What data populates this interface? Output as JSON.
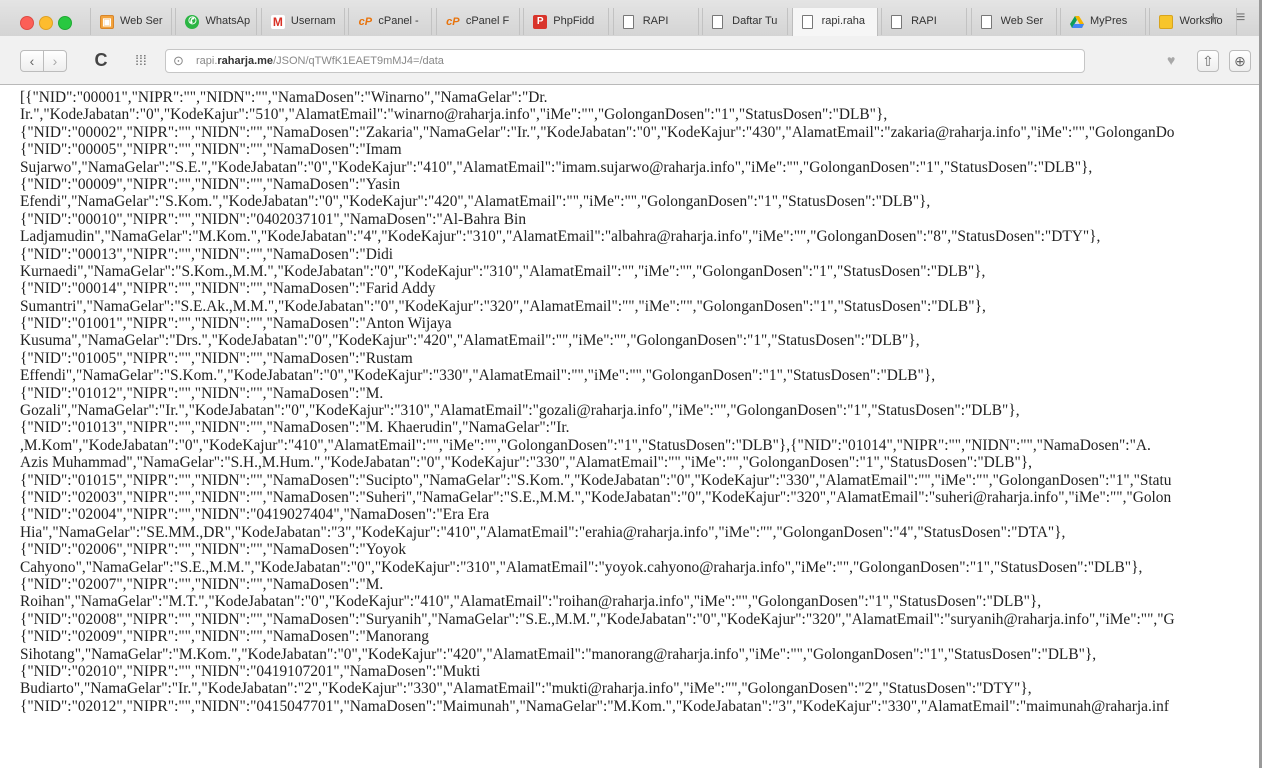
{
  "window": {
    "tabs": [
      {
        "label": "Web Ser",
        "icon": "document-icon",
        "active": false
      },
      {
        "label": "WhatsAp",
        "icon": "whatsapp-icon",
        "active": false
      },
      {
        "label": "Usernam",
        "icon": "gmail-icon",
        "active": false
      },
      {
        "label": "cPanel -",
        "icon": "cpanel-icon",
        "active": false
      },
      {
        "label": "cPanel F",
        "icon": "cpanel-icon",
        "active": false
      },
      {
        "label": "PhpFidd",
        "icon": "phpfiddle-icon",
        "active": false
      },
      {
        "label": "RAPI",
        "icon": "page-icon",
        "active": false
      },
      {
        "label": "Daftar Tu",
        "icon": "page-icon",
        "active": false
      },
      {
        "label": "rapi.raha",
        "icon": "page-icon",
        "active": true
      },
      {
        "label": "RAPI",
        "icon": "page-icon",
        "active": false
      },
      {
        "label": "Web Ser",
        "icon": "page-icon",
        "active": false
      },
      {
        "label": "MyPres",
        "icon": "google-drive-icon",
        "active": false
      },
      {
        "label": "Worksho",
        "icon": "spreadsheet-icon",
        "active": false
      }
    ],
    "new_tab": "+",
    "tab_menu": "≡"
  },
  "toolbar": {
    "back": "‹",
    "forward": "›",
    "reload": "C",
    "apps": "⁞⁞⁞",
    "url_prefix": "rapi.",
    "url_domain": "raharja.me",
    "url_path": "/JSON/qTWfK1EAET9mMJ4=/data",
    "share": "⇧",
    "download": "⊕"
  },
  "content": {
    "json_lines": [
      "[{\"NID\":\"00001\",\"NIPR\":\"\",\"NIDN\":\"\",\"NamaDosen\":\"Winarno\",\"NamaGelar\":\"Dr.",
      "Ir.\",\"KodeJabatan\":\"0\",\"KodeKajur\":\"510\",\"AlamatEmail\":\"winarno@raharja.info\",\"iMe\":\"\",\"GolonganDosen\":\"1\",\"StatusDosen\":\"DLB\"},",
      "{\"NID\":\"00002\",\"NIPR\":\"\",\"NIDN\":\"\",\"NamaDosen\":\"Zakaria\",\"NamaGelar\":\"Ir.\",\"KodeJabatan\":\"0\",\"KodeKajur\":\"430\",\"AlamatEmail\":\"zakaria@raharja.info\",\"iMe\":\"\",\"GolonganDo",
      "{\"NID\":\"00005\",\"NIPR\":\"\",\"NIDN\":\"\",\"NamaDosen\":\"Imam",
      "Sujarwo\",\"NamaGelar\":\"S.E.\",\"KodeJabatan\":\"0\",\"KodeKajur\":\"410\",\"AlamatEmail\":\"imam.sujarwo@raharja.info\",\"iMe\":\"\",\"GolonganDosen\":\"1\",\"StatusDosen\":\"DLB\"},",
      "{\"NID\":\"00009\",\"NIPR\":\"\",\"NIDN\":\"\",\"NamaDosen\":\"Yasin",
      "Efendi\",\"NamaGelar\":\"S.Kom.\",\"KodeJabatan\":\"0\",\"KodeKajur\":\"420\",\"AlamatEmail\":\"\",\"iMe\":\"\",\"GolonganDosen\":\"1\",\"StatusDosen\":\"DLB\"},",
      "{\"NID\":\"00010\",\"NIPR\":\"\",\"NIDN\":\"0402037101\",\"NamaDosen\":\"Al-Bahra Bin",
      "Ladjamudin\",\"NamaGelar\":\"M.Kom.\",\"KodeJabatan\":\"4\",\"KodeKajur\":\"310\",\"AlamatEmail\":\"albahra@raharja.info\",\"iMe\":\"\",\"GolonganDosen\":\"8\",\"StatusDosen\":\"DTY\"},",
      "{\"NID\":\"00013\",\"NIPR\":\"\",\"NIDN\":\"\",\"NamaDosen\":\"Didi",
      "Kurnaedi\",\"NamaGelar\":\"S.Kom.,M.M.\",\"KodeJabatan\":\"0\",\"KodeKajur\":\"310\",\"AlamatEmail\":\"\",\"iMe\":\"\",\"GolonganDosen\":\"1\",\"StatusDosen\":\"DLB\"},",
      "{\"NID\":\"00014\",\"NIPR\":\"\",\"NIDN\":\"\",\"NamaDosen\":\"Farid Addy",
      "Sumantri\",\"NamaGelar\":\"S.E.Ak.,M.M.\",\"KodeJabatan\":\"0\",\"KodeKajur\":\"320\",\"AlamatEmail\":\"\",\"iMe\":\"\",\"GolonganDosen\":\"1\",\"StatusDosen\":\"DLB\"},",
      "{\"NID\":\"01001\",\"NIPR\":\"\",\"NIDN\":\"\",\"NamaDosen\":\"Anton Wijaya",
      "Kusuma\",\"NamaGelar\":\"Drs.\",\"KodeJabatan\":\"0\",\"KodeKajur\":\"420\",\"AlamatEmail\":\"\",\"iMe\":\"\",\"GolonganDosen\":\"1\",\"StatusDosen\":\"DLB\"},",
      "{\"NID\":\"01005\",\"NIPR\":\"\",\"NIDN\":\"\",\"NamaDosen\":\"Rustam",
      "Effendi\",\"NamaGelar\":\"S.Kom.\",\"KodeJabatan\":\"0\",\"KodeKajur\":\"330\",\"AlamatEmail\":\"\",\"iMe\":\"\",\"GolonganDosen\":\"1\",\"StatusDosen\":\"DLB\"},",
      "{\"NID\":\"01012\",\"NIPR\":\"\",\"NIDN\":\"\",\"NamaDosen\":\"M.",
      "Gozali\",\"NamaGelar\":\"Ir.\",\"KodeJabatan\":\"0\",\"KodeKajur\":\"310\",\"AlamatEmail\":\"gozali@raharja.info\",\"iMe\":\"\",\"GolonganDosen\":\"1\",\"StatusDosen\":\"DLB\"},",
      "{\"NID\":\"01013\",\"NIPR\":\"\",\"NIDN\":\"\",\"NamaDosen\":\"M. Khaerudin\",\"NamaGelar\":\"Ir.",
      ",M.Kom\",\"KodeJabatan\":\"0\",\"KodeKajur\":\"410\",\"AlamatEmail\":\"\",\"iMe\":\"\",\"GolonganDosen\":\"1\",\"StatusDosen\":\"DLB\"},{\"NID\":\"01014\",\"NIPR\":\"\",\"NIDN\":\"\",\"NamaDosen\":\"A.",
      "Azis Muhammad\",\"NamaGelar\":\"S.H.,M.Hum.\",\"KodeJabatan\":\"0\",\"KodeKajur\":\"330\",\"AlamatEmail\":\"\",\"iMe\":\"\",\"GolonganDosen\":\"1\",\"StatusDosen\":\"DLB\"},",
      "{\"NID\":\"01015\",\"NIPR\":\"\",\"NIDN\":\"\",\"NamaDosen\":\"Sucipto\",\"NamaGelar\":\"S.Kom.\",\"KodeJabatan\":\"0\",\"KodeKajur\":\"330\",\"AlamatEmail\":\"\",\"iMe\":\"\",\"GolonganDosen\":\"1\",\"Statu",
      "{\"NID\":\"02003\",\"NIPR\":\"\",\"NIDN\":\"\",\"NamaDosen\":\"Suheri\",\"NamaGelar\":\"S.E.,M.M.\",\"KodeJabatan\":\"0\",\"KodeKajur\":\"320\",\"AlamatEmail\":\"suheri@raharja.info\",\"iMe\":\"\",\"Golon",
      "{\"NID\":\"02004\",\"NIPR\":\"\",\"NIDN\":\"0419027404\",\"NamaDosen\":\"Era Era",
      "Hia\",\"NamaGelar\":\"SE.MM.,DR\",\"KodeJabatan\":\"3\",\"KodeKajur\":\"410\",\"AlamatEmail\":\"erahia@raharja.info\",\"iMe\":\"\",\"GolonganDosen\":\"4\",\"StatusDosen\":\"DTA\"},",
      "{\"NID\":\"02006\",\"NIPR\":\"\",\"NIDN\":\"\",\"NamaDosen\":\"Yoyok",
      "Cahyono\",\"NamaGelar\":\"S.E.,M.M.\",\"KodeJabatan\":\"0\",\"KodeKajur\":\"310\",\"AlamatEmail\":\"yoyok.cahyono@raharja.info\",\"iMe\":\"\",\"GolonganDosen\":\"1\",\"StatusDosen\":\"DLB\"},",
      "{\"NID\":\"02007\",\"NIPR\":\"\",\"NIDN\":\"\",\"NamaDosen\":\"M.",
      "Roihan\",\"NamaGelar\":\"M.T.\",\"KodeJabatan\":\"0\",\"KodeKajur\":\"410\",\"AlamatEmail\":\"roihan@raharja.info\",\"iMe\":\"\",\"GolonganDosen\":\"1\",\"StatusDosen\":\"DLB\"},",
      "{\"NID\":\"02008\",\"NIPR\":\"\",\"NIDN\":\"\",\"NamaDosen\":\"Suryanih\",\"NamaGelar\":\"S.E.,M.M.\",\"KodeJabatan\":\"0\",\"KodeKajur\":\"320\",\"AlamatEmail\":\"suryanih@raharja.info\",\"iMe\":\"\",\"G",
      "{\"NID\":\"02009\",\"NIPR\":\"\",\"NIDN\":\"\",\"NamaDosen\":\"Manorang",
      "Sihotang\",\"NamaGelar\":\"M.Kom.\",\"KodeJabatan\":\"0\",\"KodeKajur\":\"420\",\"AlamatEmail\":\"manorang@raharja.info\",\"iMe\":\"\",\"GolonganDosen\":\"1\",\"StatusDosen\":\"DLB\"},",
      "{\"NID\":\"02010\",\"NIPR\":\"\",\"NIDN\":\"0419107201\",\"NamaDosen\":\"Mukti",
      "Budiarto\",\"NamaGelar\":\"Ir.\",\"KodeJabatan\":\"2\",\"KodeKajur\":\"330\",\"AlamatEmail\":\"mukti@raharja.info\",\"iMe\":\"\",\"GolonganDosen\":\"2\",\"StatusDosen\":\"DTY\"},",
      "{\"NID\":\"02012\",\"NIPR\":\"\",\"NIDN\":\"0415047701\",\"NamaDosen\":\"Maimunah\",\"NamaGelar\":\"M.Kom.\",\"KodeJabatan\":\"3\",\"KodeKajur\":\"330\",\"AlamatEmail\":\"maimunah@raharja.inf"
    ]
  },
  "colors": {
    "close": "#fc5f57",
    "minimize": "#fdbc2e",
    "maximize": "#28c840",
    "tab_active": "#f6f6f6",
    "text": "#222222"
  }
}
